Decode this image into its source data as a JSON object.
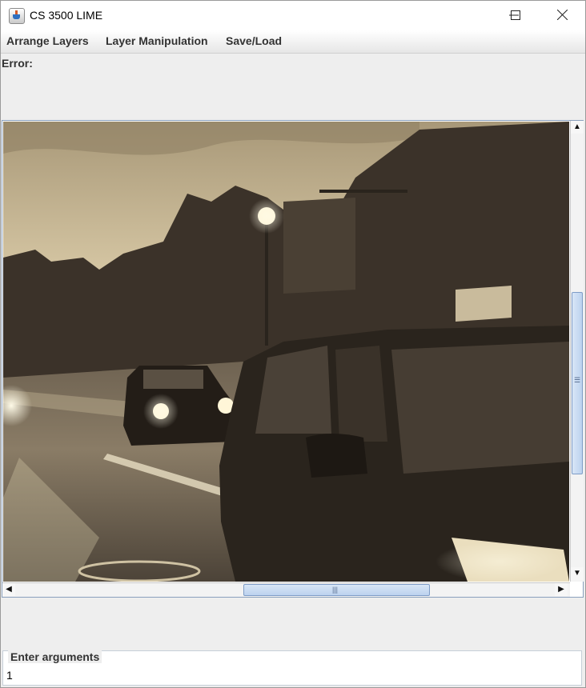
{
  "window": {
    "title": "CS 3500 LIME"
  },
  "menu": [
    "Arrange Layers",
    "Layer Manipulation",
    "Save/Load"
  ],
  "error": {
    "label": "Error:"
  },
  "arguments": {
    "label": "Enter arguments",
    "value": "1"
  },
  "image": {
    "description_tone": "sepia"
  },
  "colors": {
    "accent": "#7e9cc7",
    "sepia_light": "#e6d7b3",
    "sepia_dark": "#2a241d"
  }
}
